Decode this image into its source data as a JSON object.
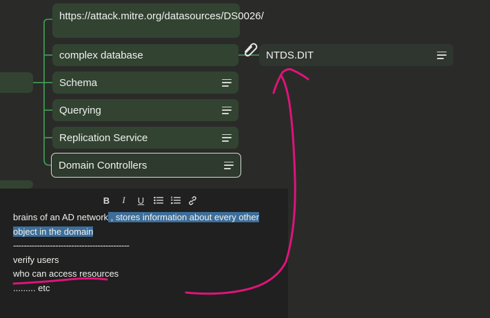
{
  "nodes": {
    "url": "https://attack.mitre.org/datasources/DS0026/",
    "complex_db": "complex database",
    "schema": "Schema",
    "querying": "Querying",
    "replication": "Replication Service",
    "domain_controllers": "Domain Controllers",
    "ntds": "NTDS.DIT"
  },
  "toolbar": {
    "bold": "B",
    "italic": "I",
    "underline": "U",
    "bullet_list": "bulleted-list-icon",
    "numbered_list": "numbered-list-icon",
    "link": "link-icon"
  },
  "note": {
    "line1_plain": "brains of an AD network",
    "line1_hl": " , stores information about every other",
    "line2_hl": "object in the domain",
    "line3": "--------------------------------------------",
    "line4": "verify users",
    "line5": "who can access resources",
    "line6": "......... etc"
  },
  "colors": {
    "background": "#2a2b29",
    "node": "#324332",
    "connector": "#3fa653",
    "annotation": "#e0137a",
    "selection": "#3d6e9a"
  }
}
